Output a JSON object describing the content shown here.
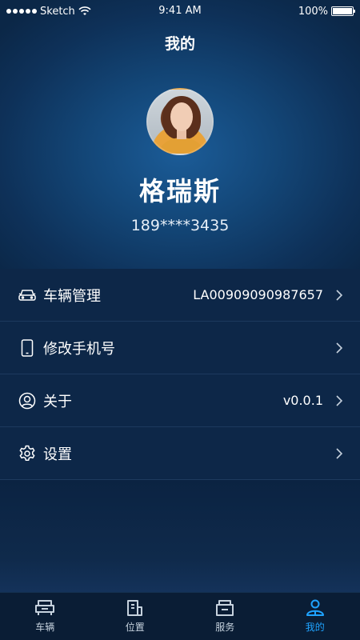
{
  "status_bar": {
    "carrier": "Sketch",
    "time": "9:41 AM",
    "battery": "100%",
    "battery_level": 1.0
  },
  "header": {
    "title": "我的"
  },
  "profile": {
    "name": "格瑞斯",
    "phone": "189****3435"
  },
  "menu": {
    "items": [
      {
        "label": "车辆管理",
        "value": "LA00909090987657",
        "icon": "car-icon"
      },
      {
        "label": "修改手机号",
        "value": "",
        "icon": "phone-icon"
      },
      {
        "label": "关于",
        "value": "v0.0.1",
        "icon": "user-circle-icon"
      },
      {
        "label": "设置",
        "value": "",
        "icon": "gear-icon"
      }
    ]
  },
  "tabbar": {
    "items": [
      {
        "label": "车辆",
        "icon": "vehicle-icon",
        "active": false
      },
      {
        "label": "位置",
        "icon": "location-icon",
        "active": false
      },
      {
        "label": "服务",
        "icon": "service-icon",
        "active": false
      },
      {
        "label": "我的",
        "icon": "profile-icon",
        "active": true
      }
    ]
  },
  "colors": {
    "background": "#0c2340",
    "accent": "#1fa3ff",
    "divider": "#1d3a5e"
  }
}
